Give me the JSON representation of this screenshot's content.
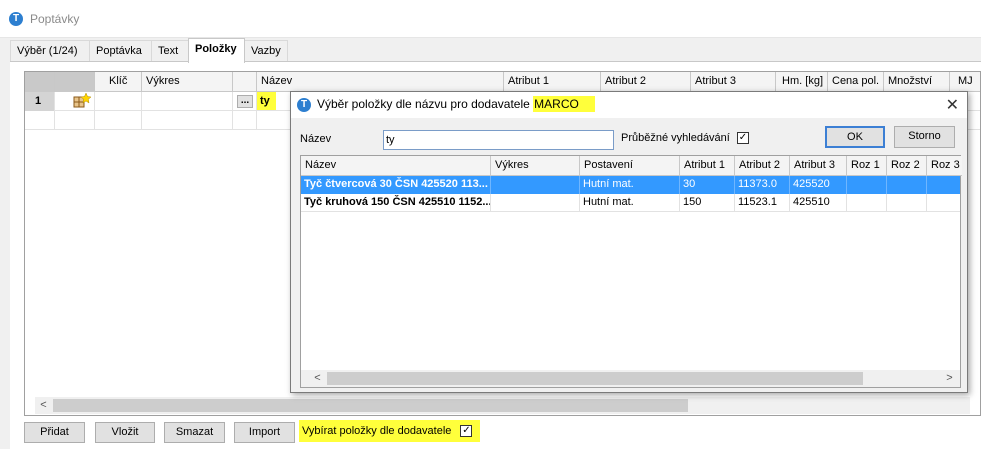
{
  "window": {
    "title": "Poptávky",
    "icon": "app-logo-icon"
  },
  "tabs": [
    {
      "label": "Výběr (1/24)"
    },
    {
      "label": "Poptávka"
    },
    {
      "label": "Text"
    },
    {
      "label": "Položky",
      "active": true
    },
    {
      "label": "Vazby"
    }
  ],
  "grid": {
    "columns": [
      "",
      "",
      "Klíč",
      "Výkres",
      "",
      "Název",
      "Atribut 1",
      "Atribut 2",
      "Atribut 3",
      "Hm. [kg]",
      "Cena pol.",
      "Množství",
      "MJ"
    ],
    "row": {
      "number": "1",
      "icon": "item-new-icon",
      "browse": "...",
      "name": "ty"
    }
  },
  "buttons": {
    "add": "Přidat",
    "insert": "Vložit",
    "delete": "Smazat",
    "import": "Import"
  },
  "supplier_filter": {
    "label": "Vybírat položky dle dodavatele",
    "checked": true,
    "check_glyph": "✓"
  },
  "dialog": {
    "title_prefix": "Výběr položky dle názvu pro dodavatele",
    "supplier": "MARCO",
    "close_glyph": "✕",
    "name_label": "Název",
    "name_value": "ty",
    "live_search_label": "Průběžné vyhledávání",
    "live_search_checked": true,
    "ok": "OK",
    "cancel": "Storno",
    "columns": [
      "Název",
      "Výkres",
      "Postavení",
      "Atribut 1",
      "Atribut 2",
      "Atribut 3",
      "Roz 1",
      "Roz 2",
      "Roz 3"
    ],
    "rows": [
      {
        "name": "Tyč čtvercová 30 ČSN 425520 113...",
        "drawing": "",
        "status": "Hutní mat.",
        "attr1": "30",
        "attr2": "11373.0",
        "attr3": "425520",
        "selected": true
      },
      {
        "name": "Tyč kruhová 150 ČSN 425510 1152...",
        "drawing": "",
        "status": "Hutní mat.",
        "attr1": "150",
        "attr2": "11523.1",
        "attr3": "425510",
        "selected": false
      }
    ]
  },
  "colors": {
    "highlight": "#ffff3b",
    "selection": "#3399ff",
    "accent": "#2d7fd0"
  },
  "scroll": {
    "left": "<",
    "right": ">"
  }
}
